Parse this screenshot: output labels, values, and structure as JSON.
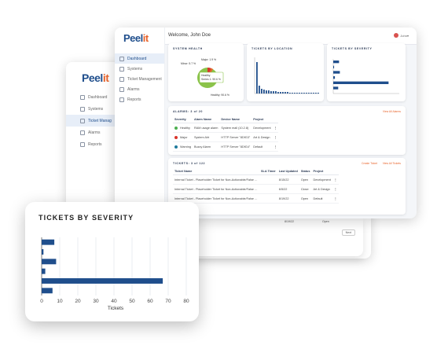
{
  "app": {
    "logo_text": "Peel",
    "logo_accent": "it"
  },
  "nav": [
    {
      "label": "Dashboard"
    },
    {
      "label": "Systems"
    },
    {
      "label": "Ticket Management"
    },
    {
      "label": "Alarms"
    },
    {
      "label": "Reports"
    }
  ],
  "nav_back": [
    {
      "label": "Dashboard"
    },
    {
      "label": "Systems"
    },
    {
      "label": "Ticket Manag"
    },
    {
      "label": "Alarms"
    },
    {
      "label": "Reports"
    }
  ],
  "header": {
    "welcome": "Welcome, John Doe",
    "user": "John"
  },
  "cards": {
    "system_health": "SYSTEM HEALTH",
    "by_location": "TICKETS BY LOCATION",
    "by_severity": "TICKETS BY SEVERITY"
  },
  "health_legend": {
    "major": "Major: 1.9 %",
    "minor": "Minor: 5.7 %",
    "tooltip_title": "Healthy",
    "tooltip_value": "Series 1: 90.6 %",
    "healthy": "Healthy: 90.6 %"
  },
  "alarms": {
    "title": "ALARMS: 3 of 20",
    "link": "View All Alarms",
    "columns": [
      "Severity",
      "Alarm Name",
      "Device Name",
      "Project"
    ],
    "rows": [
      {
        "severity": "Healthy",
        "name": "RAM usage alarm",
        "device": "System mall (10.2.8)",
        "project": "Development",
        "color": "#4caf50"
      },
      {
        "severity": "Major",
        "name": "System Alrt",
        "device": "HTTP Server \"8DfG3\"",
        "project": "Art & Design",
        "color": "#d9342b"
      },
      {
        "severity": "Warning",
        "name": "Buzzy Alarm",
        "device": "HTTP Server \"8DfG4\"",
        "project": "Default",
        "color": "#1f7a9c"
      }
    ]
  },
  "tickets": {
    "title": "TICKETS: 3 of 122",
    "link_create": "Create Ticket",
    "link_view": "View All Tickets",
    "columns": [
      "Ticket Name",
      "SLA Timer",
      "Last Updated",
      "Status",
      "Project"
    ],
    "rows": [
      {
        "name": "Internal Ticket - Placeholder Ticket for Non-Actionable/False Alarms...",
        "sla": "",
        "updated": "8/15/22",
        "status": "Open",
        "project": "Development"
      },
      {
        "name": "Internal Ticket - Placeholder Ticket for Non-Actionable/False Alarms...",
        "sla": "",
        "updated": "6/5/22",
        "status": "Close",
        "project": "Art & Design"
      },
      {
        "name": "Internal Ticket - Placeholder Ticket for Non-Actionable/False Alarms...",
        "sla": "",
        "updated": "8/19/22",
        "status": "Open",
        "project": "Default"
      }
    ]
  },
  "lower": {
    "row_date": "8/19/22",
    "row_status": "Open",
    "button": "Next"
  },
  "zoom": {
    "title": "TICKETS BY SEVERITY"
  },
  "colors": {
    "bar": "#1f4e8c",
    "accent": "#e8642c"
  },
  "chart_data": [
    {
      "type": "bar",
      "orientation": "horizontal",
      "title": "TICKETS BY SEVERITY",
      "xlabel": "Tickets",
      "ylabel": "",
      "xlim": [
        0,
        80
      ],
      "xticks": [
        0,
        10,
        20,
        30,
        40,
        50,
        60,
        70,
        80
      ],
      "categories": [
        "",
        "",
        "",
        "",
        "",
        ""
      ],
      "values": [
        7,
        1,
        8,
        2,
        67,
        6
      ],
      "grid": true
    },
    {
      "type": "pie",
      "title": "SYSTEM HEALTH",
      "categories": [
        "Healthy",
        "Minor",
        "Major"
      ],
      "values": [
        90.6,
        5.7,
        1.9
      ]
    }
  ]
}
